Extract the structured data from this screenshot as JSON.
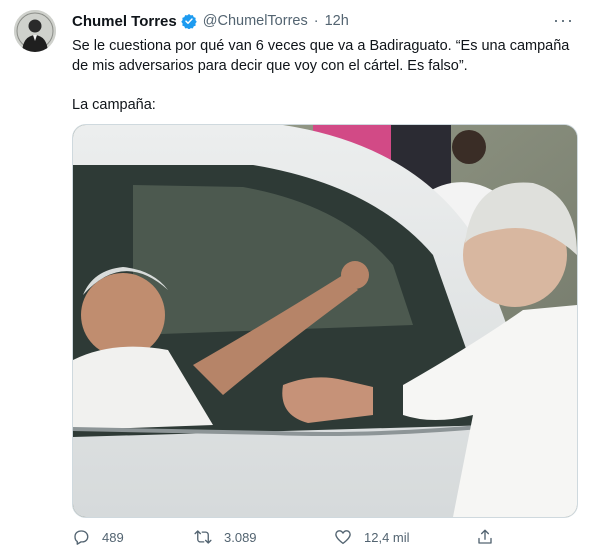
{
  "tweet": {
    "author_name": "Chumel Torres",
    "handle": "@ChumelTorres",
    "separator": "·",
    "time": "12h",
    "more_label": "···",
    "text_1": "Se le cuestiona por qué van 6 veces que va a Badiraguato. “Es una campaña de mis adversarios para decir que voy con el cártel. Es falso”.",
    "text_2": "La campaña:"
  },
  "actions": {
    "replies": "489",
    "retweets": "3.089",
    "likes": "12,4 mil"
  },
  "icons": {
    "verified": "verified-badge-icon",
    "reply": "reply-icon",
    "retweet": "retweet-icon",
    "like": "heart-icon",
    "share": "share-icon"
  },
  "colors": {
    "verified": "#1d9bf0",
    "secondary_text": "#536471"
  }
}
